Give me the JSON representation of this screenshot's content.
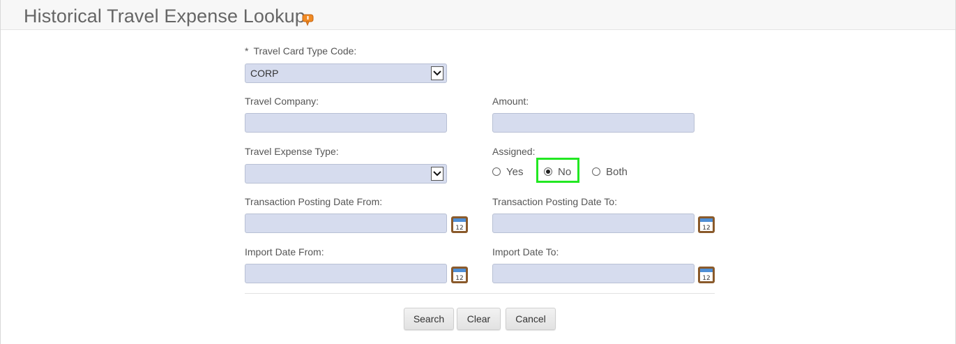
{
  "page": {
    "title": "Historical Travel Expense Lookup"
  },
  "form": {
    "card_type": {
      "required_marker": "*",
      "label": "Travel Card Type Code:",
      "value": "CORP"
    },
    "travel_company": {
      "label": "Travel Company:",
      "value": ""
    },
    "amount": {
      "label": "Amount:",
      "value": ""
    },
    "expense_type": {
      "label": "Travel Expense Type:",
      "value": ""
    },
    "assigned": {
      "label": "Assigned:",
      "options": [
        "Yes",
        "No",
        "Both"
      ],
      "selected": "No"
    },
    "posting_date_from": {
      "label": "Transaction Posting Date From:",
      "value": ""
    },
    "posting_date_to": {
      "label": "Transaction Posting Date To:",
      "value": ""
    },
    "import_date_from": {
      "label": "Import Date From:",
      "value": ""
    },
    "import_date_to": {
      "label": "Import Date To:",
      "value": ""
    }
  },
  "buttons": {
    "search": "Search",
    "clear": "Clear",
    "cancel": "Cancel"
  },
  "icons": {
    "help": "help-thumb-icon",
    "calendar": "calendar-icon"
  },
  "colors": {
    "field_bg": "#d6dcee",
    "highlight": "#22e822",
    "calendar": "#8a5a2b"
  }
}
